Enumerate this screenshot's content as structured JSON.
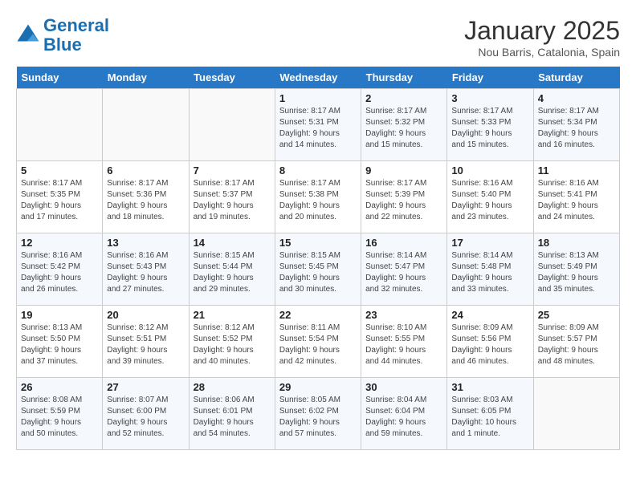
{
  "header": {
    "logo_line1": "General",
    "logo_line2": "Blue",
    "month": "January 2025",
    "location": "Nou Barris, Catalonia, Spain"
  },
  "weekdays": [
    "Sunday",
    "Monday",
    "Tuesday",
    "Wednesday",
    "Thursday",
    "Friday",
    "Saturday"
  ],
  "weeks": [
    [
      {
        "day": "",
        "info": ""
      },
      {
        "day": "",
        "info": ""
      },
      {
        "day": "",
        "info": ""
      },
      {
        "day": "1",
        "info": "Sunrise: 8:17 AM\nSunset: 5:31 PM\nDaylight: 9 hours\nand 14 minutes."
      },
      {
        "day": "2",
        "info": "Sunrise: 8:17 AM\nSunset: 5:32 PM\nDaylight: 9 hours\nand 15 minutes."
      },
      {
        "day": "3",
        "info": "Sunrise: 8:17 AM\nSunset: 5:33 PM\nDaylight: 9 hours\nand 15 minutes."
      },
      {
        "day": "4",
        "info": "Sunrise: 8:17 AM\nSunset: 5:34 PM\nDaylight: 9 hours\nand 16 minutes."
      }
    ],
    [
      {
        "day": "5",
        "info": "Sunrise: 8:17 AM\nSunset: 5:35 PM\nDaylight: 9 hours\nand 17 minutes."
      },
      {
        "day": "6",
        "info": "Sunrise: 8:17 AM\nSunset: 5:36 PM\nDaylight: 9 hours\nand 18 minutes."
      },
      {
        "day": "7",
        "info": "Sunrise: 8:17 AM\nSunset: 5:37 PM\nDaylight: 9 hours\nand 19 minutes."
      },
      {
        "day": "8",
        "info": "Sunrise: 8:17 AM\nSunset: 5:38 PM\nDaylight: 9 hours\nand 20 minutes."
      },
      {
        "day": "9",
        "info": "Sunrise: 8:17 AM\nSunset: 5:39 PM\nDaylight: 9 hours\nand 22 minutes."
      },
      {
        "day": "10",
        "info": "Sunrise: 8:16 AM\nSunset: 5:40 PM\nDaylight: 9 hours\nand 23 minutes."
      },
      {
        "day": "11",
        "info": "Sunrise: 8:16 AM\nSunset: 5:41 PM\nDaylight: 9 hours\nand 24 minutes."
      }
    ],
    [
      {
        "day": "12",
        "info": "Sunrise: 8:16 AM\nSunset: 5:42 PM\nDaylight: 9 hours\nand 26 minutes."
      },
      {
        "day": "13",
        "info": "Sunrise: 8:16 AM\nSunset: 5:43 PM\nDaylight: 9 hours\nand 27 minutes."
      },
      {
        "day": "14",
        "info": "Sunrise: 8:15 AM\nSunset: 5:44 PM\nDaylight: 9 hours\nand 29 minutes."
      },
      {
        "day": "15",
        "info": "Sunrise: 8:15 AM\nSunset: 5:45 PM\nDaylight: 9 hours\nand 30 minutes."
      },
      {
        "day": "16",
        "info": "Sunrise: 8:14 AM\nSunset: 5:47 PM\nDaylight: 9 hours\nand 32 minutes."
      },
      {
        "day": "17",
        "info": "Sunrise: 8:14 AM\nSunset: 5:48 PM\nDaylight: 9 hours\nand 33 minutes."
      },
      {
        "day": "18",
        "info": "Sunrise: 8:13 AM\nSunset: 5:49 PM\nDaylight: 9 hours\nand 35 minutes."
      }
    ],
    [
      {
        "day": "19",
        "info": "Sunrise: 8:13 AM\nSunset: 5:50 PM\nDaylight: 9 hours\nand 37 minutes."
      },
      {
        "day": "20",
        "info": "Sunrise: 8:12 AM\nSunset: 5:51 PM\nDaylight: 9 hours\nand 39 minutes."
      },
      {
        "day": "21",
        "info": "Sunrise: 8:12 AM\nSunset: 5:52 PM\nDaylight: 9 hours\nand 40 minutes."
      },
      {
        "day": "22",
        "info": "Sunrise: 8:11 AM\nSunset: 5:54 PM\nDaylight: 9 hours\nand 42 minutes."
      },
      {
        "day": "23",
        "info": "Sunrise: 8:10 AM\nSunset: 5:55 PM\nDaylight: 9 hours\nand 44 minutes."
      },
      {
        "day": "24",
        "info": "Sunrise: 8:09 AM\nSunset: 5:56 PM\nDaylight: 9 hours\nand 46 minutes."
      },
      {
        "day": "25",
        "info": "Sunrise: 8:09 AM\nSunset: 5:57 PM\nDaylight: 9 hours\nand 48 minutes."
      }
    ],
    [
      {
        "day": "26",
        "info": "Sunrise: 8:08 AM\nSunset: 5:59 PM\nDaylight: 9 hours\nand 50 minutes."
      },
      {
        "day": "27",
        "info": "Sunrise: 8:07 AM\nSunset: 6:00 PM\nDaylight: 9 hours\nand 52 minutes."
      },
      {
        "day": "28",
        "info": "Sunrise: 8:06 AM\nSunset: 6:01 PM\nDaylight: 9 hours\nand 54 minutes."
      },
      {
        "day": "29",
        "info": "Sunrise: 8:05 AM\nSunset: 6:02 PM\nDaylight: 9 hours\nand 57 minutes."
      },
      {
        "day": "30",
        "info": "Sunrise: 8:04 AM\nSunset: 6:04 PM\nDaylight: 9 hours\nand 59 minutes."
      },
      {
        "day": "31",
        "info": "Sunrise: 8:03 AM\nSunset: 6:05 PM\nDaylight: 10 hours\nand 1 minute."
      },
      {
        "day": "",
        "info": ""
      }
    ]
  ]
}
